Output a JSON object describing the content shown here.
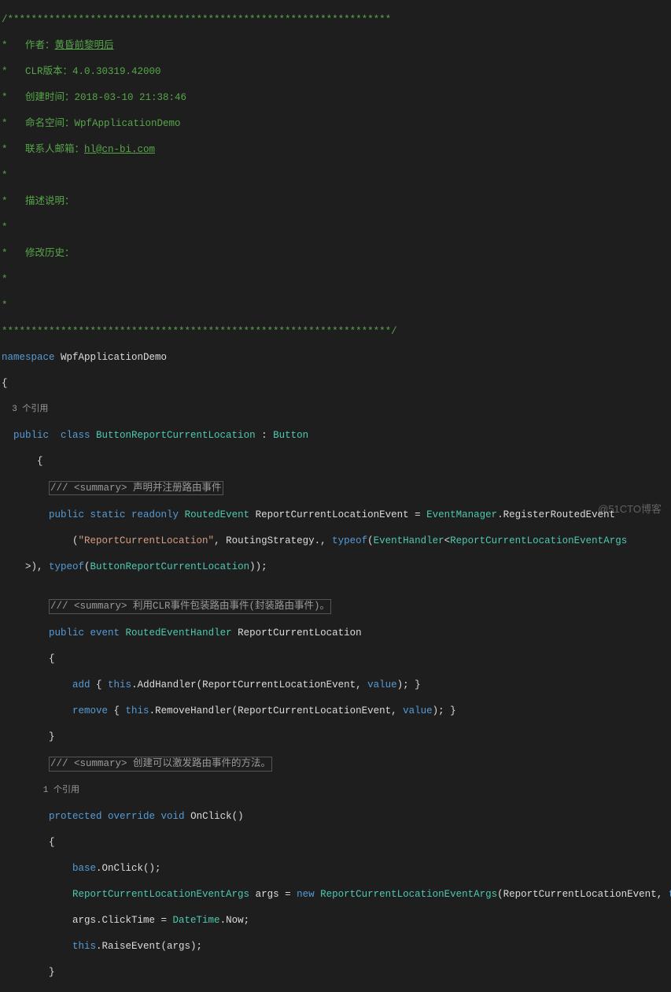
{
  "header": {
    "stars_line": "/*****************************************************************",
    "author_prefix": "*   作者：",
    "author_value": "黄昏前黎明后",
    "clr_prefix": "*   CLR版本：",
    "clr_value": "4.0.30319.42000",
    "created_prefix": "*   创建时间：",
    "created_value": "2018-03-10 21:38:46",
    "ns_prefix": "*   命名空间：",
    "ns_value": "WpfApplicationDemo",
    "email_prefix": "*   联系人邮箱：",
    "email_value": "hl@cn-bi.com",
    "blank1": "*   ",
    "desc_prefix": "*   描述说明：",
    "desc_value": "",
    "blank2": "*   ",
    "history_prefix": "*   修改历史：",
    "history_value": "",
    "blank3": "*   ",
    "blank4": "*",
    "stars_end": "******************************************************************/"
  },
  "code": {
    "ns_kw": "namespace",
    "ns_name": " WpfApplicationDemo",
    "brace_o": "{",
    "ref3": "  3 个引用",
    "class_line": {
      "public": "  public",
      "class_kw": "  class",
      "class_name": " ButtonReportCurrentLocation",
      "colon": " : ",
      "base": "Button"
    },
    "brace_o2": "      {",
    "summary1": "/// <summary> 声明并注册路由事件",
    "register_line": {
      "prefix": "        ",
      "public": "public",
      "static": " static",
      "readonly": " readonly",
      "type": " RoutedEvent",
      "name": " ReportCurrentLocationEvent",
      "eq": " = ",
      "em": "EventManager",
      "dot": ".RegisterRoutedEvent"
    },
    "register_line2": {
      "prefix": "            (",
      "str": "\"ReportCurrentLocation\"",
      "mid": ", RoutingStrategy., ",
      "typeof_kw": "typeof",
      "open": "(",
      "eh": "EventHandler",
      "lt": "<",
      "args": "ReportCurrentLocationEventArgs"
    },
    "register_line3": {
      "prefix": "    >), ",
      "typeof_kw": "typeof",
      "open": "(",
      "cls": "ButtonReportCurrentLocation",
      "end": "));"
    },
    "blank": "",
    "summary2": "/// <summary> 利用CLR事件包装路由事件(封装路由事件)。",
    "event_line": {
      "prefix": "        ",
      "public": "public",
      "event": " event",
      "type": " RoutedEventHandler",
      "name": " ReportCurrentLocation"
    },
    "brace_o3": "        {",
    "add_line": {
      "prefix": "            ",
      "add": "add",
      "open": " { ",
      "this": "this",
      "mid": ".AddHandler(ReportCurrentLocationEvent, ",
      "value": "value",
      "end": "); }"
    },
    "remove_line": {
      "prefix": "            ",
      "remove": "remove",
      "open": " { ",
      "this": "this",
      "mid": ".RemoveHandler(ReportCurrentLocationEvent, ",
      "value": "value",
      "end": "); }"
    },
    "brace_c3": "        }",
    "summary3": "/// <summary> 创建可以激发路由事件的方法。",
    "ref1": "        1 个引用",
    "onclick_line": {
      "prefix": "        ",
      "protected": "protected",
      "override": " override",
      "void": " void",
      "name": " OnClick",
      "end": "()"
    },
    "brace_o4": "        {",
    "base_line": {
      "prefix": "            ",
      "base": "base",
      "end": ".OnClick();"
    },
    "args_line": {
      "prefix": "            ",
      "type": "ReportCurrentLocationEventArgs",
      "name": " args",
      "eq": " = ",
      "new": "new",
      "type2": " ReportCurrentLocationEventArgs",
      "open": "(ReportCurrentLocationEvent, ",
      "this": "this",
      "end": ");"
    },
    "clicktime_line": {
      "prefix": "            args.ClickTime = ",
      "dt": "DateTime",
      "end": ".Now;"
    },
    "raise_line": {
      "prefix": "            ",
      "this": "this",
      "end": ".RaiseEvent(args);"
    },
    "brace_c4": "        }"
  },
  "watermark": "@51CTO博客"
}
